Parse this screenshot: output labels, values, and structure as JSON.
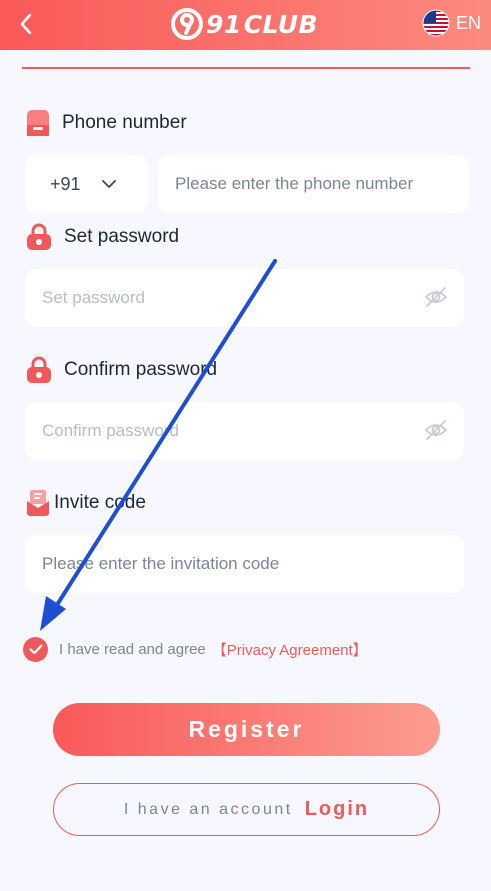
{
  "header": {
    "logo_number": "91",
    "logo_text": "CLUB",
    "language": "EN"
  },
  "phone": {
    "label": "Phone number",
    "country_code": "+91",
    "placeholder": "Please enter the phone number"
  },
  "set_password": {
    "label": "Set password",
    "placeholder": "Set password"
  },
  "confirm_password": {
    "label": "Confirm password",
    "placeholder": "Confirm password"
  },
  "invite": {
    "label": "Invite code",
    "placeholder": "Please enter the invitation code"
  },
  "agreement": {
    "checked": true,
    "text": "I have read and agree",
    "link": "【Privacy Agreement】"
  },
  "buttons": {
    "register": "Register",
    "have_account": "I have an account",
    "login": "Login"
  },
  "colors": {
    "accent": "#ee5a5a",
    "annotation_arrow": "#1f4fd1"
  }
}
